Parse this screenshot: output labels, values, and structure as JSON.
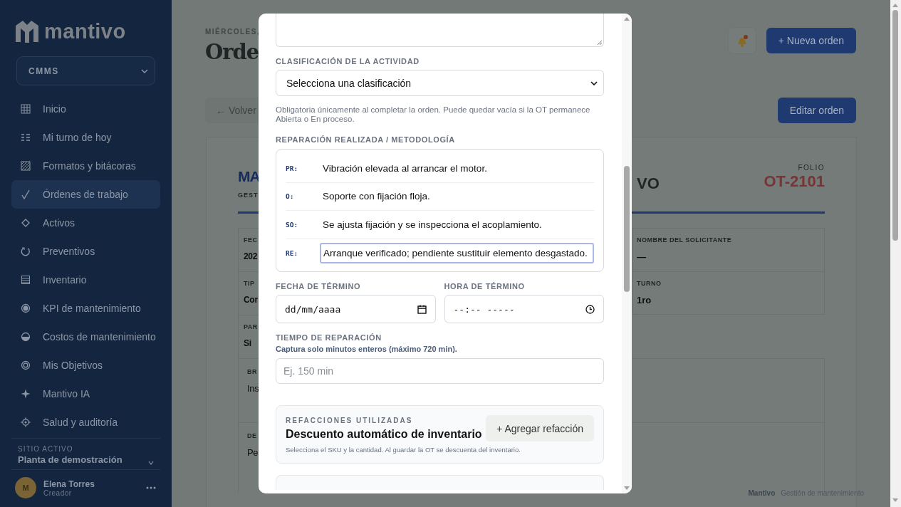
{
  "sidebar": {
    "logo": "mantivo",
    "module_select": "CMMS",
    "nav": [
      {
        "label": "Inicio",
        "selected": false
      },
      {
        "label": "Mi turno de hoy",
        "selected": false
      },
      {
        "label": "Formatos y bitácoras",
        "selected": false
      },
      {
        "label": "Órdenes de trabajo",
        "selected": true
      },
      {
        "label": "Activos",
        "selected": false
      },
      {
        "label": "Preventivos",
        "selected": false
      },
      {
        "label": "Inventario",
        "selected": false
      },
      {
        "label": "KPI de mantenimiento",
        "selected": false
      },
      {
        "label": "Costos de mantenimiento",
        "selected": false
      },
      {
        "label": "Mis Objetivos",
        "selected": false
      },
      {
        "label": "Mantivo IA",
        "selected": false
      },
      {
        "label": "Salud y auditoría",
        "selected": false
      }
    ],
    "active_site": {
      "label": "SITIO ACTIVO",
      "value": "Planta de demostración"
    },
    "user": {
      "initial": "M",
      "name": "Elena Torres",
      "role": "Creador"
    }
  },
  "page": {
    "date": "MIÉRCOLES,",
    "title": "Orde",
    "back_button": "← Volver",
    "new_order_button": "+ Nueva orden",
    "edit_button": "Editar orden",
    "card": {
      "heading": "MA",
      "heading_tail": "VO",
      "subheading": "GEST",
      "folio_label": "FOLIO",
      "folio": "OT-2101",
      "fields": [
        {
          "label": "FEC",
          "value": "202"
        },
        {
          "label": "TIP",
          "value": "Cor"
        },
        {
          "label": "PAR",
          "value": "Si"
        }
      ],
      "right_fields": [
        {
          "label": "NOMBRE DEL SOLICITANTE",
          "value": "—"
        },
        {
          "label": "TURNO",
          "value": "1ro"
        }
      ],
      "blocks": [
        {
          "label": "BR",
          "value": "Ins"
        },
        {
          "label": "DE",
          "value": "Pe"
        }
      ]
    },
    "footer": {
      "brand": "Mantivo",
      "text": "Gestión de mantenimiento"
    }
  },
  "modal": {
    "classification": {
      "label": "CLASIFICACIÓN DE LA ACTIVIDAD",
      "value": "Selecciona una clasificación",
      "help": "Obligatoria únicamente al completar la orden. Puede quedar vacía si la OT permanece Abierta o En proceso."
    },
    "repair": {
      "label": "REPARACIÓN REALIZADA / METODOLOGÍA",
      "rows": [
        {
          "code": "PR:",
          "text": "Vibración elevada al arrancar el motor.",
          "focused": false
        },
        {
          "code": "O:",
          "text": "Soporte con fijación floja.",
          "focused": false
        },
        {
          "code": "SO:",
          "text": "Se ajusta fijación y se inspecciona el acoplamiento.",
          "focused": false
        },
        {
          "code": "RE:",
          "text": "Arranque verificado; pendiente sustituir elemento desgastado.",
          "focused": true
        }
      ]
    },
    "end_date": {
      "label": "FECHA DE TÉRMINO",
      "placeholder": "dd/mm/aaaa"
    },
    "end_time": {
      "label": "HORA DE TÉRMINO",
      "placeholder": "--:-- -----"
    },
    "repair_time": {
      "label": "TIEMPO DE REPARACIÓN",
      "hint": "Captura solo minutos enteros (máximo 720 min).",
      "placeholder": "Ej. 150 min"
    },
    "parts": {
      "eyebrow": "REFACCIONES UTILIZADAS",
      "title": "Descuento automático de inventario",
      "button": "+ Agregar refacción",
      "note": "Selecciona el SKU y la cantidad. Al guardar la OT se descuenta del inventario."
    }
  }
}
